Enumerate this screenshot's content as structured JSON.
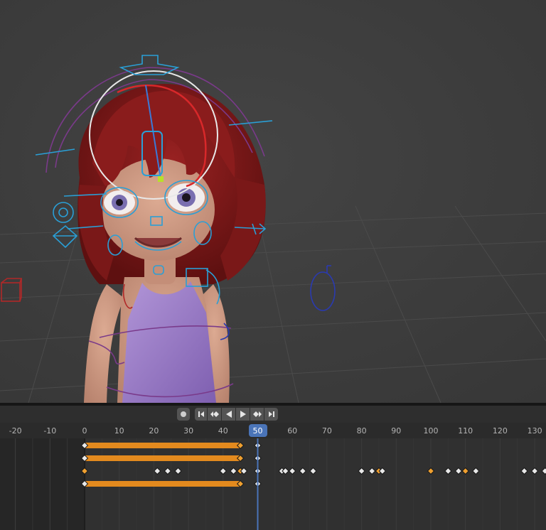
{
  "viewport": {
    "description_colors": {
      "background": "#3d3d3d",
      "grid": "#4a4a4a",
      "hair": "#7a1a1a",
      "dress": "#9c7bc4",
      "skin": "#cf9a84",
      "rig": "#2a9fd6"
    }
  },
  "timeline": {
    "ruler_labels": [
      "-20",
      "-10",
      "0",
      "10",
      "20",
      "30",
      "40",
      "50",
      "60",
      "70",
      "80",
      "90",
      "100",
      "110",
      "120",
      "130"
    ],
    "ruler_frames": [
      -20,
      -10,
      0,
      10,
      20,
      30,
      40,
      50,
      60,
      70,
      80,
      90,
      100,
      110,
      120,
      130
    ],
    "current_frame": "50",
    "buttons": [
      {
        "name": "auto-keying-button",
        "icon": "record-dot-icon"
      },
      {
        "name": "jump-to-start-button",
        "icon": "skip-start-icon"
      },
      {
        "name": "prev-keyframe-button",
        "icon": "prev-keyframe-icon"
      },
      {
        "name": "play-reverse-button",
        "icon": "play-reverse-icon"
      },
      {
        "name": "play-button",
        "icon": "play-icon"
      },
      {
        "name": "next-keyframe-button",
        "icon": "next-keyframe-icon"
      },
      {
        "name": "jump-to-end-button",
        "icon": "skip-end-icon"
      }
    ],
    "colors": {
      "hold_bar": "#e38a1e",
      "key_selected": "#f0a030",
      "key_normal": "#e8e8e8",
      "playhead": "#4a74b8"
    },
    "channels": [
      {
        "hold_bars": [
          [
            0,
            45
          ]
        ],
        "keys": [
          {
            "f": 0,
            "sel": false
          },
          {
            "f": 45,
            "sel": true
          },
          {
            "f": 50,
            "sel": false
          }
        ]
      },
      {
        "hold_bars": [
          [
            0,
            45
          ]
        ],
        "keys": [
          {
            "f": 0,
            "sel": false
          },
          {
            "f": 45,
            "sel": true
          },
          {
            "f": 50,
            "sel": false
          }
        ]
      },
      {
        "hold_bars": [],
        "keys": [
          {
            "f": 0,
            "sel": true
          },
          {
            "f": 21,
            "sel": false
          },
          {
            "f": 24,
            "sel": false
          },
          {
            "f": 27,
            "sel": false
          },
          {
            "f": 40,
            "sel": false
          },
          {
            "f": 43,
            "sel": false
          },
          {
            "f": 45,
            "sel": true
          },
          {
            "f": 46,
            "sel": false
          },
          {
            "f": 50,
            "sel": false
          },
          {
            "f": 57,
            "sel": false
          },
          {
            "f": 58,
            "sel": false
          },
          {
            "f": 60,
            "sel": false
          },
          {
            "f": 63,
            "sel": false
          },
          {
            "f": 66,
            "sel": false
          },
          {
            "f": 80,
            "sel": false
          },
          {
            "f": 83,
            "sel": false
          },
          {
            "f": 85,
            "sel": true
          },
          {
            "f": 86,
            "sel": false
          },
          {
            "f": 100,
            "sel": true
          },
          {
            "f": 105,
            "sel": false
          },
          {
            "f": 108,
            "sel": false
          },
          {
            "f": 110,
            "sel": true
          },
          {
            "f": 113,
            "sel": false
          },
          {
            "f": 127,
            "sel": false
          },
          {
            "f": 130,
            "sel": false
          },
          {
            "f": 133,
            "sel": false
          }
        ]
      },
      {
        "hold_bars": [
          [
            0,
            45
          ]
        ],
        "keys": [
          {
            "f": 0,
            "sel": false
          },
          {
            "f": 45,
            "sel": true
          },
          {
            "f": 50,
            "sel": false
          }
        ]
      }
    ]
  }
}
